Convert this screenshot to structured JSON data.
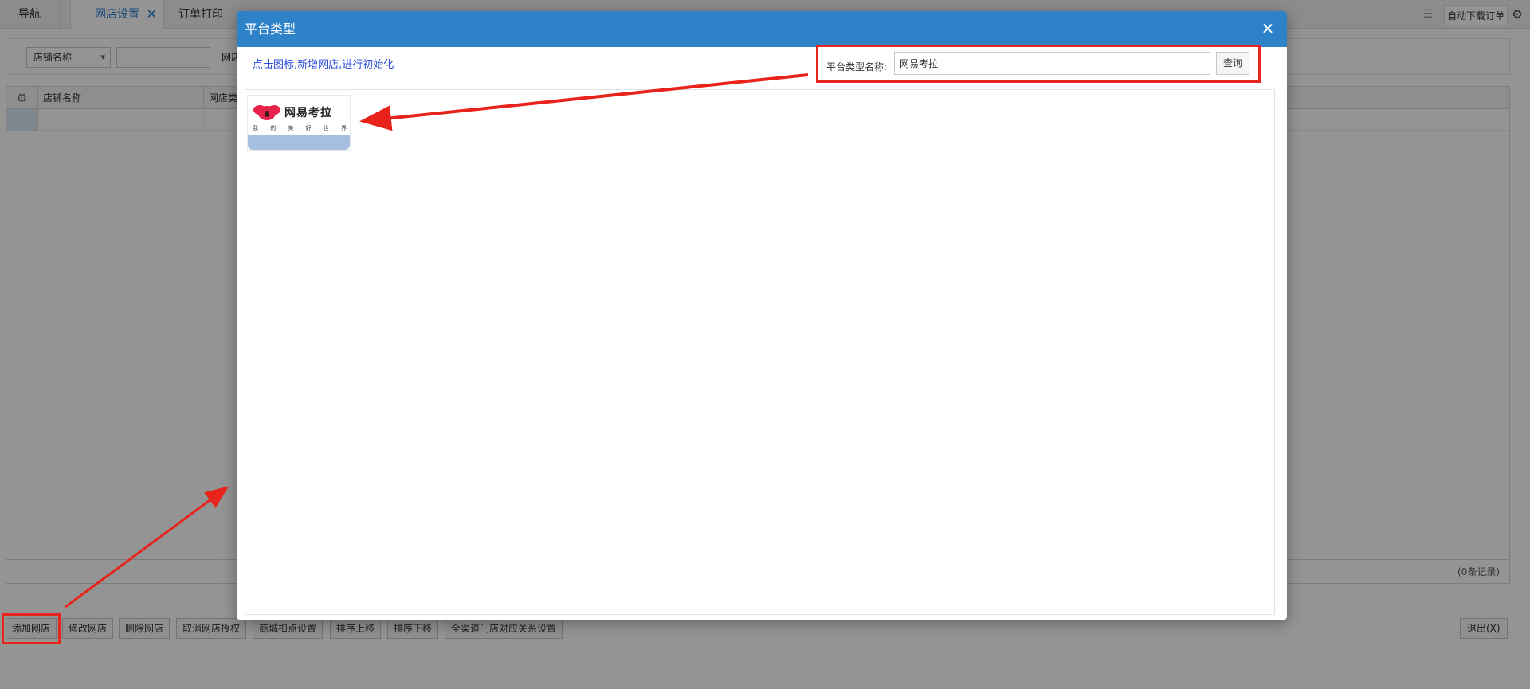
{
  "tabs": {
    "nav": "导航",
    "shop_settings": "网店设置",
    "order_print": "订单打印",
    "close_symbol": "✕"
  },
  "top_right": {
    "auto_download": "自动下载订单"
  },
  "filter": {
    "store_select_value": "店铺名称",
    "second_label": "网店"
  },
  "grid": {
    "columns": [
      "店铺名称",
      "网店类型"
    ],
    "record_count": "(0条记录)"
  },
  "buttons": {
    "add_shop": "添加网店",
    "edit_shop": "修改网店",
    "delete_shop": "删除网店",
    "cancel_auth": "取消网店授权",
    "mall_deduction": "商城扣点设置",
    "sort_up": "排序上移",
    "sort_down": "排序下移",
    "channel_mapping": "全渠道门店对应关系设置",
    "exit": "退出(X)"
  },
  "modal": {
    "title": "平台类型",
    "close_symbol": "✕",
    "hint": "点击图标,新增网店,进行初始化",
    "search_label": "平台类型名称:",
    "search_value": "网易考拉",
    "search_button": "查询"
  },
  "platforms": [
    {
      "name": "网易考拉",
      "slogan": [
        "我",
        "的",
        "美",
        "好",
        "世",
        "界"
      ],
      "icon": "kaola-logo"
    }
  ],
  "colors": {
    "header_blue": "#2d82c8",
    "highlight_red": "#e8231c",
    "hint_blue": "#2a4bd7"
  }
}
